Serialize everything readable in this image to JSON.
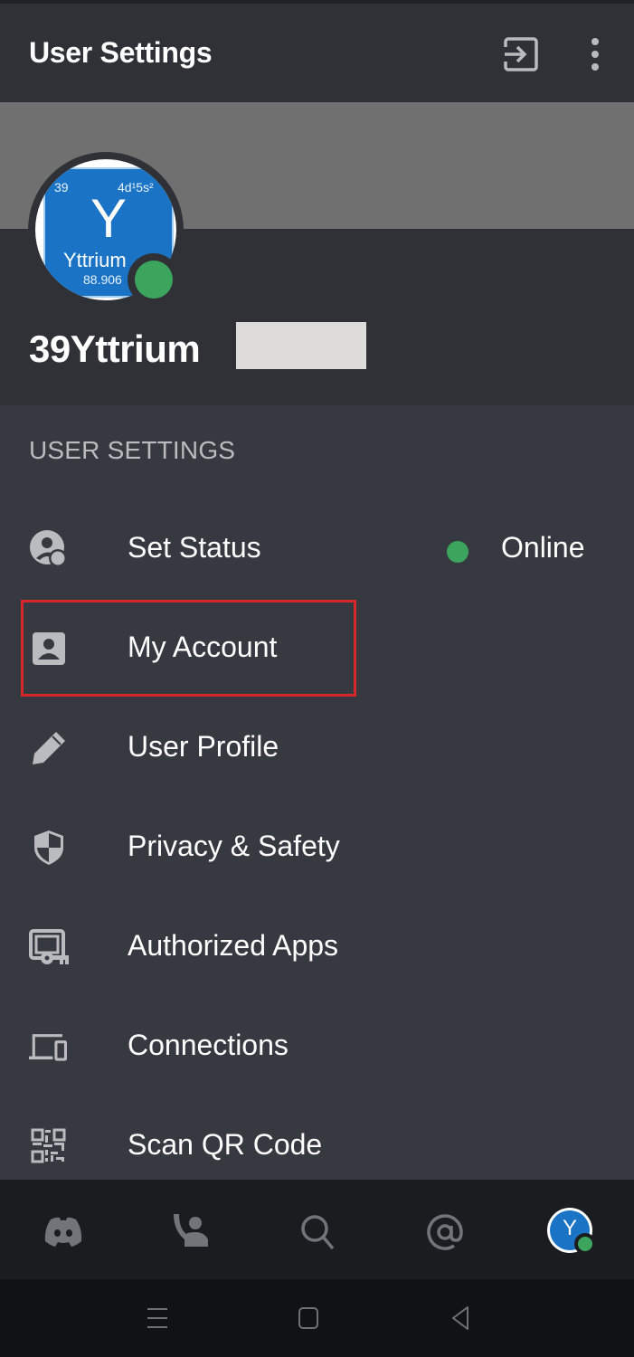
{
  "header": {
    "title": "User Settings",
    "logout_icon": "logout-icon",
    "more_icon": "more-vertical-icon"
  },
  "profile": {
    "username": "39Yttrium",
    "username_redacted": true,
    "status": "online",
    "avatar": {
      "atomic_number": "39",
      "electron_config": "4d¹5s²",
      "symbol": "Y",
      "element_name": "Yttrium",
      "atomic_mass": "88.906"
    }
  },
  "settings": {
    "section_label": "USER SETTINGS",
    "items": [
      {
        "label": "Set Status",
        "icon": "set-status-icon",
        "value": "Online",
        "highlighted": false
      },
      {
        "label": "My Account",
        "icon": "account-icon",
        "highlighted": true
      },
      {
        "label": "User Profile",
        "icon": "pencil-icon",
        "highlighted": false
      },
      {
        "label": "Privacy & Safety",
        "icon": "shield-icon",
        "highlighted": false
      },
      {
        "label": "Authorized Apps",
        "icon": "authorized-apps-icon",
        "highlighted": false
      },
      {
        "label": "Connections",
        "icon": "devices-icon",
        "highlighted": false
      },
      {
        "label": "Scan QR Code",
        "icon": "qr-code-icon",
        "highlighted": false
      }
    ]
  },
  "tabbar": {
    "tabs": [
      {
        "name": "home",
        "icon": "discord-icon"
      },
      {
        "name": "friends",
        "icon": "friends-icon"
      },
      {
        "name": "search",
        "icon": "search-icon"
      },
      {
        "name": "mentions",
        "icon": "at-icon"
      },
      {
        "name": "profile",
        "icon": "avatar",
        "selected": true
      }
    ]
  },
  "android_nav": [
    "menu",
    "home",
    "back"
  ],
  "colors": {
    "online": "#3ba55d",
    "highlight": "#d7262c",
    "background": "#36393f",
    "header": "#2f3136"
  }
}
